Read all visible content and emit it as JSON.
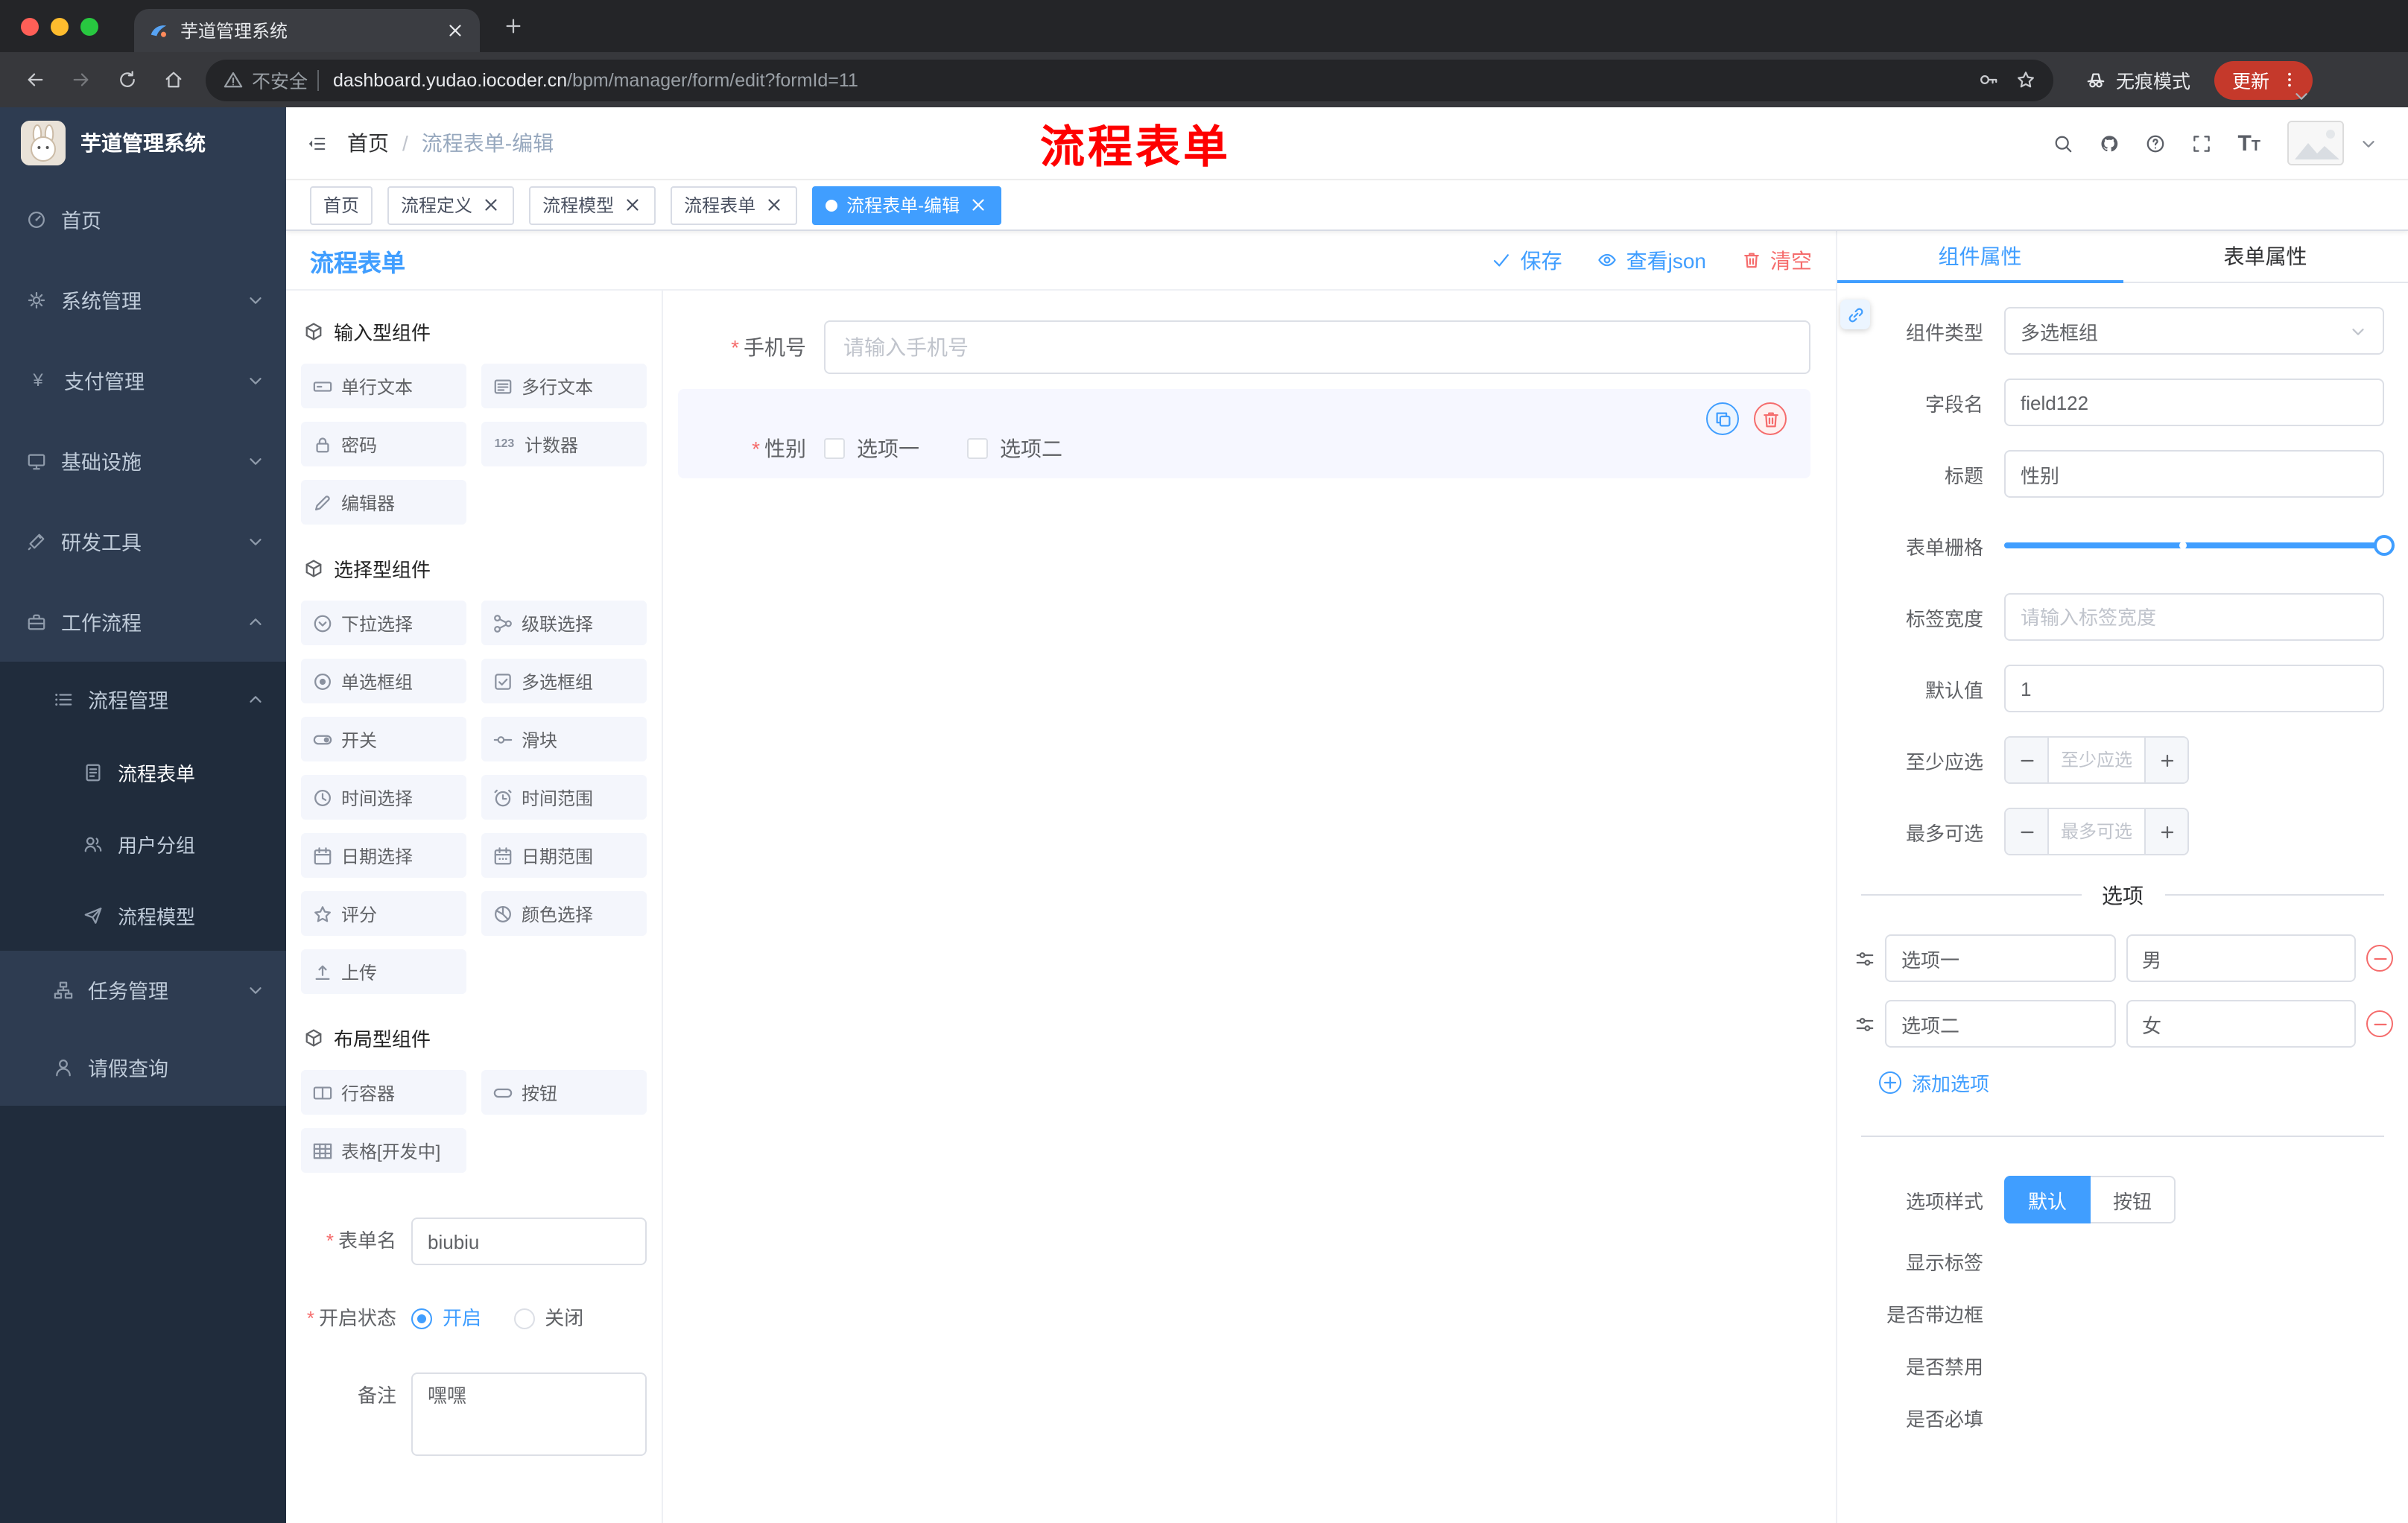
{
  "browser": {
    "tab_title": "芋道管理系统",
    "security": "不安全",
    "url_domain": "dashboard.yudao.iocoder.cn",
    "url_path": "/bpm/manager/form/edit?formId=11",
    "incognito": "无痕模式",
    "update": "更新"
  },
  "sidebar": {
    "title": "芋道管理系统",
    "items": [
      {
        "label": "首页"
      },
      {
        "label": "系统管理"
      },
      {
        "label": "支付管理"
      },
      {
        "label": "基础设施"
      },
      {
        "label": "研发工具"
      },
      {
        "label": "工作流程"
      },
      {
        "label": "流程管理"
      },
      {
        "label": "流程表单"
      },
      {
        "label": "用户分组"
      },
      {
        "label": "流程模型"
      },
      {
        "label": "任务管理"
      },
      {
        "label": "请假查询"
      }
    ]
  },
  "header": {
    "breadcrumb_home": "首页",
    "breadcrumb_sep": "/",
    "breadcrumb_current": "流程表单-编辑",
    "annotation": "流程表单"
  },
  "tags": {
    "items": [
      {
        "label": "首页"
      },
      {
        "label": "流程定义"
      },
      {
        "label": "流程模型"
      },
      {
        "label": "流程表单"
      },
      {
        "label": "流程表单-编辑"
      }
    ]
  },
  "designer": {
    "title": "流程表单",
    "save": "保存",
    "view_json": "查看json",
    "clear": "清空"
  },
  "components": {
    "input_title": "输入型组件",
    "input_items": [
      "单行文本",
      "多行文本",
      "密码",
      "计数器",
      "编辑器"
    ],
    "counter_icon_text": "123",
    "select_title": "选择型组件",
    "select_items": [
      "下拉选择",
      "级联选择",
      "单选框组",
      "多选框组",
      "开关",
      "滑块",
      "时间选择",
      "时间范围",
      "日期选择",
      "日期范围",
      "评分",
      "颜色选择",
      "上传"
    ],
    "layout_title": "布局型组件",
    "layout_items": [
      "行容器",
      "按钮",
      "表格[开发中]"
    ]
  },
  "form_settings": {
    "name_label": "表单名",
    "name_value": "biubiu",
    "status_label": "开启状态",
    "status_on": "开启",
    "status_off": "关闭",
    "remark_label": "备注",
    "remark_value": "嘿嘿"
  },
  "canvas": {
    "phone_label": "手机号",
    "phone_placeholder": "请输入手机号",
    "gender_label": "性别",
    "gender_option1": "选项一",
    "gender_option2": "选项二"
  },
  "props": {
    "tab_component": "组件属性",
    "tab_form": "表单属性",
    "type_label": "组件类型",
    "type_value": "多选框组",
    "field_label": "字段名",
    "field_value": "field122",
    "title_label": "标题",
    "title_value": "性别",
    "grid_label": "表单栅格",
    "width_label": "标签宽度",
    "width_placeholder": "请输入标签宽度",
    "default_label": "默认值",
    "default_value": "1",
    "min_label": "至少应选",
    "min_placeholder": "至少应选",
    "max_label": "最多可选",
    "max_placeholder": "最多可选",
    "options_title": "选项",
    "options": [
      {
        "name": "选项一",
        "value": "男"
      },
      {
        "name": "选项二",
        "value": "女"
      }
    ],
    "add_option": "添加选项",
    "style_label": "选项样式",
    "style_options": [
      "默认",
      "按钮"
    ],
    "toggles": [
      {
        "label": "显示标签",
        "on": true
      },
      {
        "label": "是否带边框",
        "on": false
      },
      {
        "label": "是否禁用",
        "on": false
      },
      {
        "label": "是否必填",
        "on": true
      }
    ]
  },
  "colors": {
    "accent": "#409eff",
    "danger": "#f56c6c",
    "annotation_red": "#fe0000"
  }
}
